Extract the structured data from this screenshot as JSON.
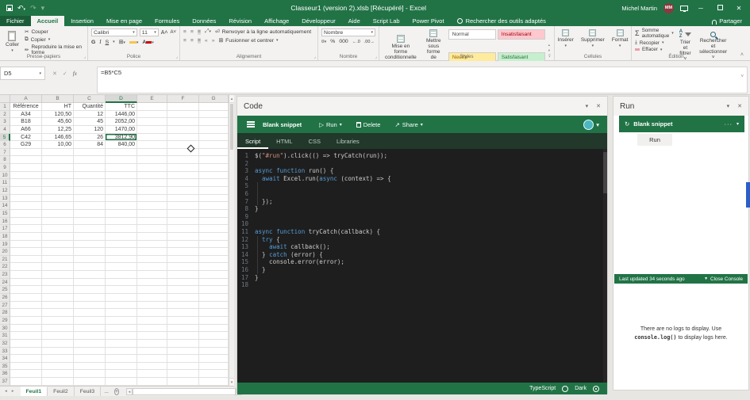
{
  "titlebar": {
    "title": "Classeur1 (version 2).xlsb [Récupéré] - Excel",
    "user": "Michel Martin",
    "initials": "MM"
  },
  "ribbon": {
    "tabs": [
      "Fichier",
      "Accueil",
      "Insertion",
      "Mise en page",
      "Formules",
      "Données",
      "Révision",
      "Affichage",
      "Développeur",
      "Aide",
      "Script Lab",
      "Power Pivot"
    ],
    "active_tab": "Accueil",
    "search": "Rechercher des outils adaptés",
    "share": "Partager",
    "groups": {
      "clipboard": {
        "label": "Presse-papiers",
        "paste": "Coller",
        "cut": "Couper",
        "copy": "Copier",
        "format_painter": "Reproduire la mise en forme"
      },
      "font": {
        "label": "Police",
        "font_name": "Calibri",
        "font_size": "11",
        "bold": "G",
        "italic": "I",
        "underline": "S"
      },
      "alignment": {
        "label": "Alignement",
        "wrap": "Renvoyer à la ligne automatiquement",
        "merge": "Fusionner et centrer"
      },
      "number": {
        "label": "Nombre",
        "format": "Nombre"
      },
      "styles": {
        "label": "Styles",
        "conditional": "Mise en forme conditionnelle ˅",
        "table": "Mettre sous forme de tableau ˅",
        "gallery": [
          {
            "label": "Normal",
            "bg": "#ffffff",
            "fg": "#444444"
          },
          {
            "label": "Insatisfaisant",
            "bg": "#ffc7ce",
            "fg": "#9c0006"
          },
          {
            "label": "Neutre",
            "bg": "#ffeb9c",
            "fg": "#9c6500"
          },
          {
            "label": "Satisfaisant",
            "bg": "#c6efce",
            "fg": "#276f35"
          }
        ]
      },
      "cells": {
        "label": "Cellules",
        "insert": "Insérer",
        "delete": "Supprimer",
        "format": "Format"
      },
      "editing": {
        "label": "Édition",
        "autosum": "Somme automatique",
        "fill": "Recopier",
        "clear": "Effacer",
        "sort": "Trier et filtrer",
        "find": "Rechercher et sélectionner"
      }
    }
  },
  "formula_bar": {
    "cell_ref": "D5",
    "formula": "=B5*C5"
  },
  "spreadsheet": {
    "columns": [
      "A",
      "B",
      "C",
      "D",
      "E",
      "F",
      "G"
    ],
    "row_count": 37,
    "selected": {
      "col": "D",
      "row": 5
    },
    "cells": [
      [
        "Référence",
        "HT",
        "Quantité",
        "TTC"
      ],
      [
        "A34",
        "120,50",
        "12",
        "1446,00"
      ],
      [
        "B18",
        "45,60",
        "45",
        "2052,00"
      ],
      [
        "A66",
        "12,25",
        "120",
        "1470,00"
      ],
      [
        "C42",
        "146,65",
        "26",
        "3812,90"
      ],
      [
        "G29",
        "10,00",
        "84",
        "840,00"
      ]
    ],
    "sheets": [
      "Feuil1",
      "Feuil2",
      "Feuil3"
    ],
    "active_sheet": "Feuil1",
    "more_tabs": "...",
    "selection_color": "#1e7145"
  },
  "code_pane": {
    "title": "Code",
    "snippet": "Blank snippet",
    "run_label": "Run",
    "delete_label": "Delete",
    "share_label": "Share",
    "tabs": [
      "Script",
      "HTML",
      "CSS",
      "Libraries"
    ],
    "active_tab": "Script",
    "footer": {
      "language": "TypeScript",
      "theme": "Dark"
    },
    "lines": [
      {
        "n": 1,
        "tokens": [
          [
            "p",
            "$("
          ],
          [
            "s",
            "\"#run\""
          ],
          [
            "p",
            ").click(() => tryCatch(run));"
          ]
        ]
      },
      {
        "n": 2,
        "tokens": []
      },
      {
        "n": 3,
        "tokens": [
          [
            "k",
            "async"
          ],
          [
            "p",
            " "
          ],
          [
            "k",
            "function"
          ],
          [
            "p",
            " run() {"
          ]
        ]
      },
      {
        "n": 4,
        "tokens": [
          [
            "p",
            "  "
          ],
          [
            "k",
            "await"
          ],
          [
            "p",
            " Excel.run("
          ],
          [
            "k",
            "async"
          ],
          [
            "p",
            " (context) => {"
          ]
        ]
      },
      {
        "n": 5,
        "tokens": [],
        "g": true
      },
      {
        "n": 6,
        "tokens": [],
        "g": true
      },
      {
        "n": 7,
        "tokens": [
          [
            "p",
            "  });"
          ]
        ],
        "g": true
      },
      {
        "n": 8,
        "tokens": [
          [
            "p",
            "}"
          ]
        ]
      },
      {
        "n": 9,
        "tokens": []
      },
      {
        "n": 10,
        "tokens": []
      },
      {
        "n": 11,
        "tokens": [
          [
            "k",
            "async"
          ],
          [
            "p",
            " "
          ],
          [
            "k",
            "function"
          ],
          [
            "p",
            " tryCatch(callback) {"
          ]
        ]
      },
      {
        "n": 12,
        "tokens": [
          [
            "p",
            "  "
          ],
          [
            "k",
            "try"
          ],
          [
            "p",
            " {"
          ]
        ],
        "g": true
      },
      {
        "n": 13,
        "tokens": [
          [
            "p",
            "    "
          ],
          [
            "k",
            "await"
          ],
          [
            "p",
            " callback();"
          ]
        ],
        "g": true
      },
      {
        "n": 14,
        "tokens": [
          [
            "p",
            "  } "
          ],
          [
            "k",
            "catch"
          ],
          [
            "p",
            " (error) {"
          ]
        ],
        "g": true
      },
      {
        "n": 15,
        "tokens": [
          [
            "p",
            "    console.error(error);"
          ]
        ],
        "g": true
      },
      {
        "n": 16,
        "tokens": [
          [
            "p",
            "  }"
          ]
        ],
        "g": true
      },
      {
        "n": 17,
        "tokens": [
          [
            "p",
            "}"
          ]
        ]
      },
      {
        "n": 18,
        "tokens": []
      }
    ]
  },
  "run_pane": {
    "title": "Run",
    "snippet": "Blank snippet",
    "run_button": "Run",
    "last_updated": "Last updated 34 seconds ago",
    "close_console": "Close Console",
    "empty_pre": "There are no logs to display. Use",
    "empty_code": "console.log()",
    "empty_post": "to display logs here."
  }
}
